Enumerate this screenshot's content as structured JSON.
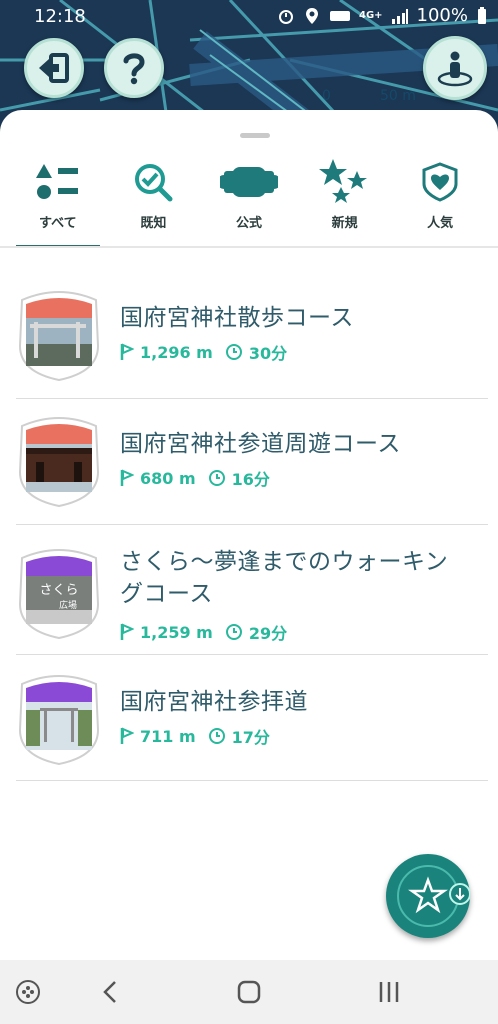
{
  "status_bar": {
    "time": "12:18",
    "battery_percent": "100%",
    "network_label": "4G+"
  },
  "map": {
    "scale_label": "50 m",
    "scale_zero": "0"
  },
  "tabs": [
    {
      "label": "すべて",
      "icon": "all-list-icon",
      "selected": true
    },
    {
      "label": "既知",
      "icon": "search-check-icon",
      "selected": false
    },
    {
      "label": "公式",
      "icon": "official-banner-icon",
      "selected": false
    },
    {
      "label": "新規",
      "icon": "new-stars-icon",
      "selected": false
    },
    {
      "label": "人気",
      "icon": "popular-heart-icon",
      "selected": false
    }
  ],
  "routes": [
    {
      "title": "国府宮神社散歩コース",
      "distance": "1,296 m",
      "duration": "30分",
      "badge_color": "#e9715f"
    },
    {
      "title": "国府宮神社参道周遊コース",
      "distance": "680 m",
      "duration": "16分",
      "badge_color": "#e9715f"
    },
    {
      "title": "さくら〜夢逢までのウォーキングコース",
      "title_line1": "さくら〜夢逢までのウォーキン",
      "title_line2": "グコース",
      "distance": "1,259 m",
      "duration": "29分",
      "badge_color": "#8a4ad6",
      "badge_text": "さくら",
      "badge_subtext": "広場"
    },
    {
      "title": "国府宮神社参拝道",
      "distance": "711 m",
      "duration": "17分",
      "badge_color": "#8a4ad6"
    }
  ],
  "colors": {
    "accent": "#28b89c",
    "title": "#2f5b6a",
    "tab_underline": "#2f6c6c",
    "fab": "#1a847c"
  },
  "icons": {
    "exit": "exit-icon",
    "help": "help-icon",
    "avatar": "avatar-location-icon",
    "fab": "star-download-icon"
  }
}
